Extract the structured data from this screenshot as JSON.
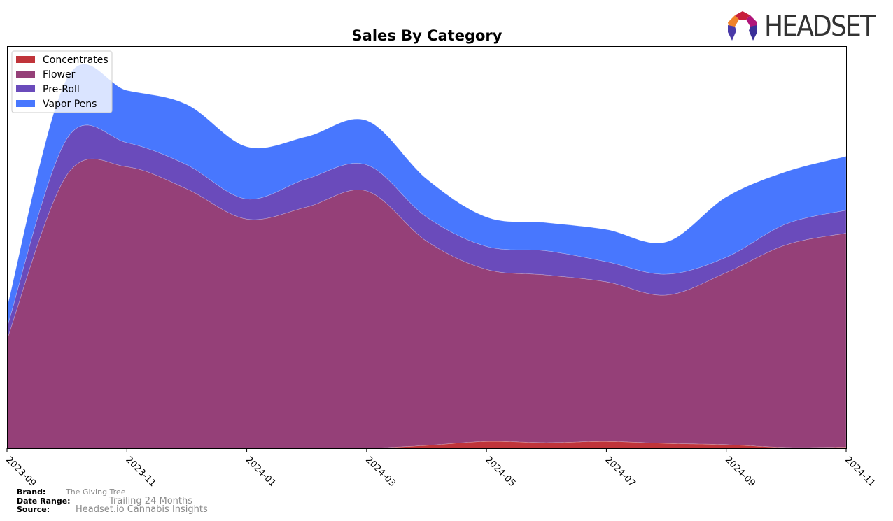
{
  "brand_logo": {
    "text": "HEADSET"
  },
  "footer": {
    "brand_label": "Brand:",
    "brand_value": "The Giving Tree",
    "date_range_label": "Date Range:",
    "date_range_value": "Trailing 24 Months",
    "source_label": "Source:",
    "source_value": "Headset.io Cannabis Insights"
  },
  "chart_data": {
    "type": "area",
    "stacked": true,
    "smoothed": true,
    "title": "Sales By Category",
    "xlabel": "",
    "ylabel": "",
    "y_ticks_visible": false,
    "ylim": [
      0,
      100
    ],
    "grid": false,
    "legend_position": "top-left",
    "x": [
      "2023-09",
      "2023-10",
      "2023-11",
      "2023-12",
      "2024-01",
      "2024-02",
      "2024-03",
      "2024-04",
      "2024-05",
      "2024-06",
      "2024-07",
      "2024-08",
      "2024-09",
      "2024-10",
      "2024-11"
    ],
    "x_tick_labels": [
      "2023-09",
      "2023-11",
      "2024-01",
      "2024-03",
      "2024-05",
      "2024-07",
      "2024-09",
      "2024-11"
    ],
    "series": [
      {
        "name": "Concentrates",
        "color": "#c0343a",
        "values": [
          0,
          0,
          0,
          0,
          0,
          0,
          0,
          0.7,
          1.7,
          1.4,
          1.7,
          1.2,
          0.9,
          0.2,
          0.3
        ]
      },
      {
        "name": "Flower",
        "color": "#954078",
        "values": [
          27,
          68,
          70,
          64.5,
          57,
          60,
          64,
          50.8,
          42.8,
          41.7,
          39.7,
          36.9,
          42.8,
          50.4,
          53.2
        ]
      },
      {
        "name": "Pre-Roll",
        "color": "#6a4bbb",
        "values": [
          3,
          9,
          6,
          6,
          5,
          7,
          6.5,
          6,
          5.7,
          6,
          5,
          5.2,
          3.8,
          5.2,
          5.7
        ]
      },
      {
        "name": "Vapor Pens",
        "color": "#4877fe",
        "values": [
          5,
          15,
          13,
          15,
          13,
          10.5,
          11,
          9.5,
          7.3,
          7,
          8,
          8,
          15,
          13,
          13.4
        ]
      }
    ]
  }
}
